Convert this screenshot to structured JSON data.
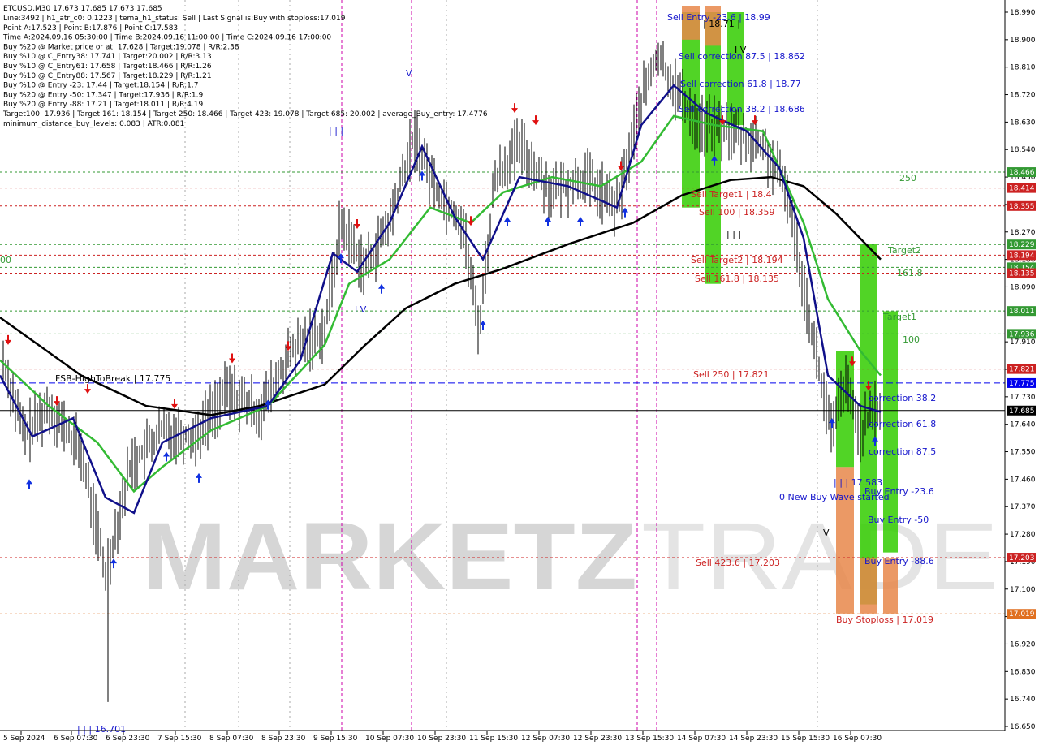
{
  "window": {
    "title": "ETCUSD,M30  17.673 17.685 17.673 17.685"
  },
  "info_lines": [
    "Line:3492 | h1_atr_c0: 0.1223 | tema_h1_status: Sell | Last Signal is:Buy with stoploss:17.019",
    "Point A:17.523 | Point B:17.876 | Point C:17.583",
    "Time A:2024.09.16 05:30:00 | Time B:2024.09.16 11:00:00 | Time C:2024.09.16 17:00:00",
    "Buy %20 @ Market price or at: 17.628 | Target:19.078 | R/R:2.38",
    "Buy %10 @ C_Entry38: 17.741 | Target:20.002 | R/R:3.13",
    "Buy %10 @ C_Entry61: 17.658 | Target:18.466 | R/R:1.26",
    "Buy %10 @ C_Entry88: 17.567 | Target:18.229 | R/R:1.21",
    "Buy %10 @ Entry -23: 17.44 | Target:18.154 | R/R:1.7",
    "Buy %20 @ Entry -50: 17.347 | Target:17.936 | R/R:1.9",
    "Buy %20 @ Entry -88: 17.21 | Target:18.011 | R/R:4.19",
    "Target100: 17.936 | Target 161: 18.154 | Target 250: 18.466 | Target 423: 19.078 | Target 685: 20.002 | average_Buy_entry: 17.4776",
    "minimum_distance_buy_levels: 0.083 | ATR:0.081"
  ],
  "watermark": {
    "part1": "MARKETZ",
    "part2": "TRADE"
  },
  "colors": {
    "green_zone": "#33cc00",
    "orange_zone": "#e8874a",
    "ma_black": "#000000",
    "ma_green": "#33bb33",
    "ma_blue": "#10108a",
    "red": "#cc0000",
    "blue_label": "#1515cc",
    "dark_green": "#339933",
    "dashed_blue": "#0000ee",
    "magenta": "#cc00aa",
    "price_tag": "#b0b0b0"
  },
  "chart_data": {
    "type": "candlestick",
    "symbol": "ETCUSD",
    "timeframe": "M30",
    "ylim": [
      16.65,
      19.01
    ],
    "y_ticks": [
      "18.990",
      "18.900",
      "18.810",
      "18.720",
      "18.630",
      "18.540",
      "18.450",
      "18.360",
      "18.270",
      "18.180",
      "18.090",
      "17.910",
      "17.820",
      "17.730",
      "17.640",
      "17.550",
      "17.460",
      "17.370",
      "17.280",
      "17.190",
      "17.100",
      "17.010",
      "16.920",
      "16.830",
      "16.740",
      "16.650"
    ],
    "x_ticks": [
      "5 Sep 2024",
      "6 Sep 07:30",
      "6 Sep 23:30",
      "7 Sep 15:30",
      "8 Sep 07:30",
      "8 Sep 23:30",
      "9 Sep 15:30",
      "10 Sep 07:30",
      "10 Sep 23:30",
      "11 Sep 15:30",
      "12 Sep 07:30",
      "12 Sep 23:30",
      "13 Sep 15:30",
      "14 Sep 07:30",
      "14 Sep 23:30",
      "15 Sep 15:30",
      "16 Sep 07:30"
    ],
    "horizontal_levels": [
      {
        "value": 18.466,
        "tag": "18.466",
        "color": "#339933"
      },
      {
        "value": 18.414,
        "tag": "18.414",
        "color": "#cc2222"
      },
      {
        "value": 18.355,
        "tag": "18.355",
        "color": "#cc2222"
      },
      {
        "value": 18.229,
        "tag": "18.229",
        "color": "#339933"
      },
      {
        "value": 18.194,
        "tag": "18.194",
        "color": "#cc2222"
      },
      {
        "value": 18.154,
        "tag": "18.154",
        "color": "#339933"
      },
      {
        "value": 18.135,
        "tag": "18.135",
        "color": "#cc2222"
      },
      {
        "value": 18.011,
        "tag": "18.011",
        "color": "#339933"
      },
      {
        "value": 17.936,
        "tag": "17.936",
        "color": "#339933"
      },
      {
        "value": 17.821,
        "tag": "17.821",
        "color": "#cc2222"
      },
      {
        "value": 17.775,
        "tag": "17.775",
        "color": "#0000ee"
      },
      {
        "value": 17.685,
        "tag": "17.685",
        "color": "#000000"
      },
      {
        "value": 17.203,
        "tag": "17.203",
        "color": "#cc2222"
      },
      {
        "value": 17.019,
        "tag": "17.019",
        "color": "#e07020"
      }
    ],
    "labels": [
      {
        "text": "Sell Entry -23.6 | 18.99",
        "color": "#1515cc"
      },
      {
        "text": "Sell correction 87.5 | 18.862",
        "color": "#1515cc"
      },
      {
        "text": "Sell correction 61.8 | 18.77",
        "color": "#1515cc"
      },
      {
        "text": "Sell correction 38.2 | 18.686",
        "color": "#1515cc"
      },
      {
        "text": "Sell Target1 | 18.4",
        "color": "#cc2222"
      },
      {
        "text": "Sell 100 | 18.359",
        "color": "#cc2222"
      },
      {
        "text": "Sell Target2 | 18.194",
        "color": "#cc2222"
      },
      {
        "text": "Sell 161.8 | 18.135",
        "color": "#cc2222"
      },
      {
        "text": "Sell  250 | 17.821",
        "color": "#cc2222"
      },
      {
        "text": "Sell  423.6 | 17.203",
        "color": "#cc2222"
      },
      {
        "text": "FSB-HighToBreak | 17.775",
        "color": "#000000"
      },
      {
        "text": "250",
        "color": "#339933"
      },
      {
        "text": "Target2",
        "color": "#339933"
      },
      {
        "text": "161.8",
        "color": "#339933"
      },
      {
        "text": "Target1",
        "color": "#339933"
      },
      {
        "text": "100",
        "color": "#339933"
      },
      {
        "text": "correction 38.2",
        "color": "#1515cc"
      },
      {
        "text": "correction 61.8",
        "color": "#1515cc"
      },
      {
        "text": "correction 87.5",
        "color": "#1515cc"
      },
      {
        "text": "| | | 17.583",
        "color": "#1515cc"
      },
      {
        "text": "0 New Buy Wave started",
        "color": "#1515cc"
      },
      {
        "text": "Buy Entry -23.6",
        "color": "#1515cc"
      },
      {
        "text": "Buy Entry -50",
        "color": "#1515cc"
      },
      {
        "text": "Buy Entry -88.6",
        "color": "#1515cc"
      },
      {
        "text": "Buy Stoploss | 17.019",
        "color": "#cc2222"
      },
      {
        "text": "| 18.71 |",
        "color": "#000000"
      },
      {
        "text": "I V",
        "color": "#1515cc"
      },
      {
        "text": "V",
        "color": "#1515cc"
      },
      {
        "text": "| | |",
        "color": "#1515cc"
      },
      {
        "text": "I V",
        "color": "#000000"
      },
      {
        "text": "| | |",
        "color": "#000000"
      },
      {
        "text": "V",
        "color": "#000000"
      },
      {
        "text": "00",
        "color": "#339933"
      },
      {
        "text": "| | | 16.701",
        "color": "#1515cc"
      }
    ],
    "grid": false,
    "legend": "none"
  }
}
